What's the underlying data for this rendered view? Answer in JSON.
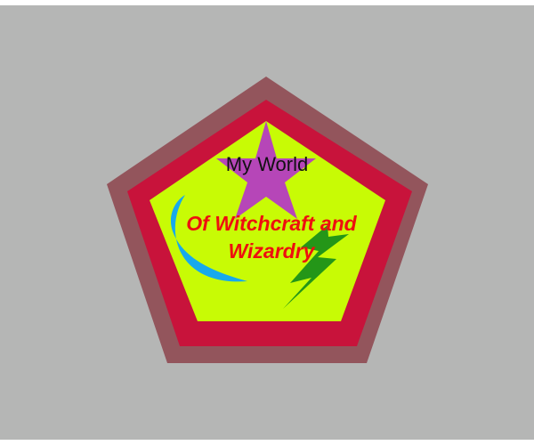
{
  "emblem": {
    "title": "My World",
    "subtitle_line1": "Of Witchcraft and",
    "subtitle_line2": "Wizardry"
  },
  "colors": {
    "background": "#b5b6b5",
    "outer_pentagon": "#93555c",
    "middle_pentagon": "#c8133b",
    "inner_pentagon": "#c8fb05",
    "star": "#b646b8",
    "moon": "#17a9ec",
    "lightning": "#249618",
    "title_text": "#111111",
    "subtitle_text": "#ee0f0f"
  },
  "icons": [
    "pentagon-badge-icon",
    "star-icon",
    "crescent-moon-icon",
    "lightning-bolt-icon"
  ]
}
